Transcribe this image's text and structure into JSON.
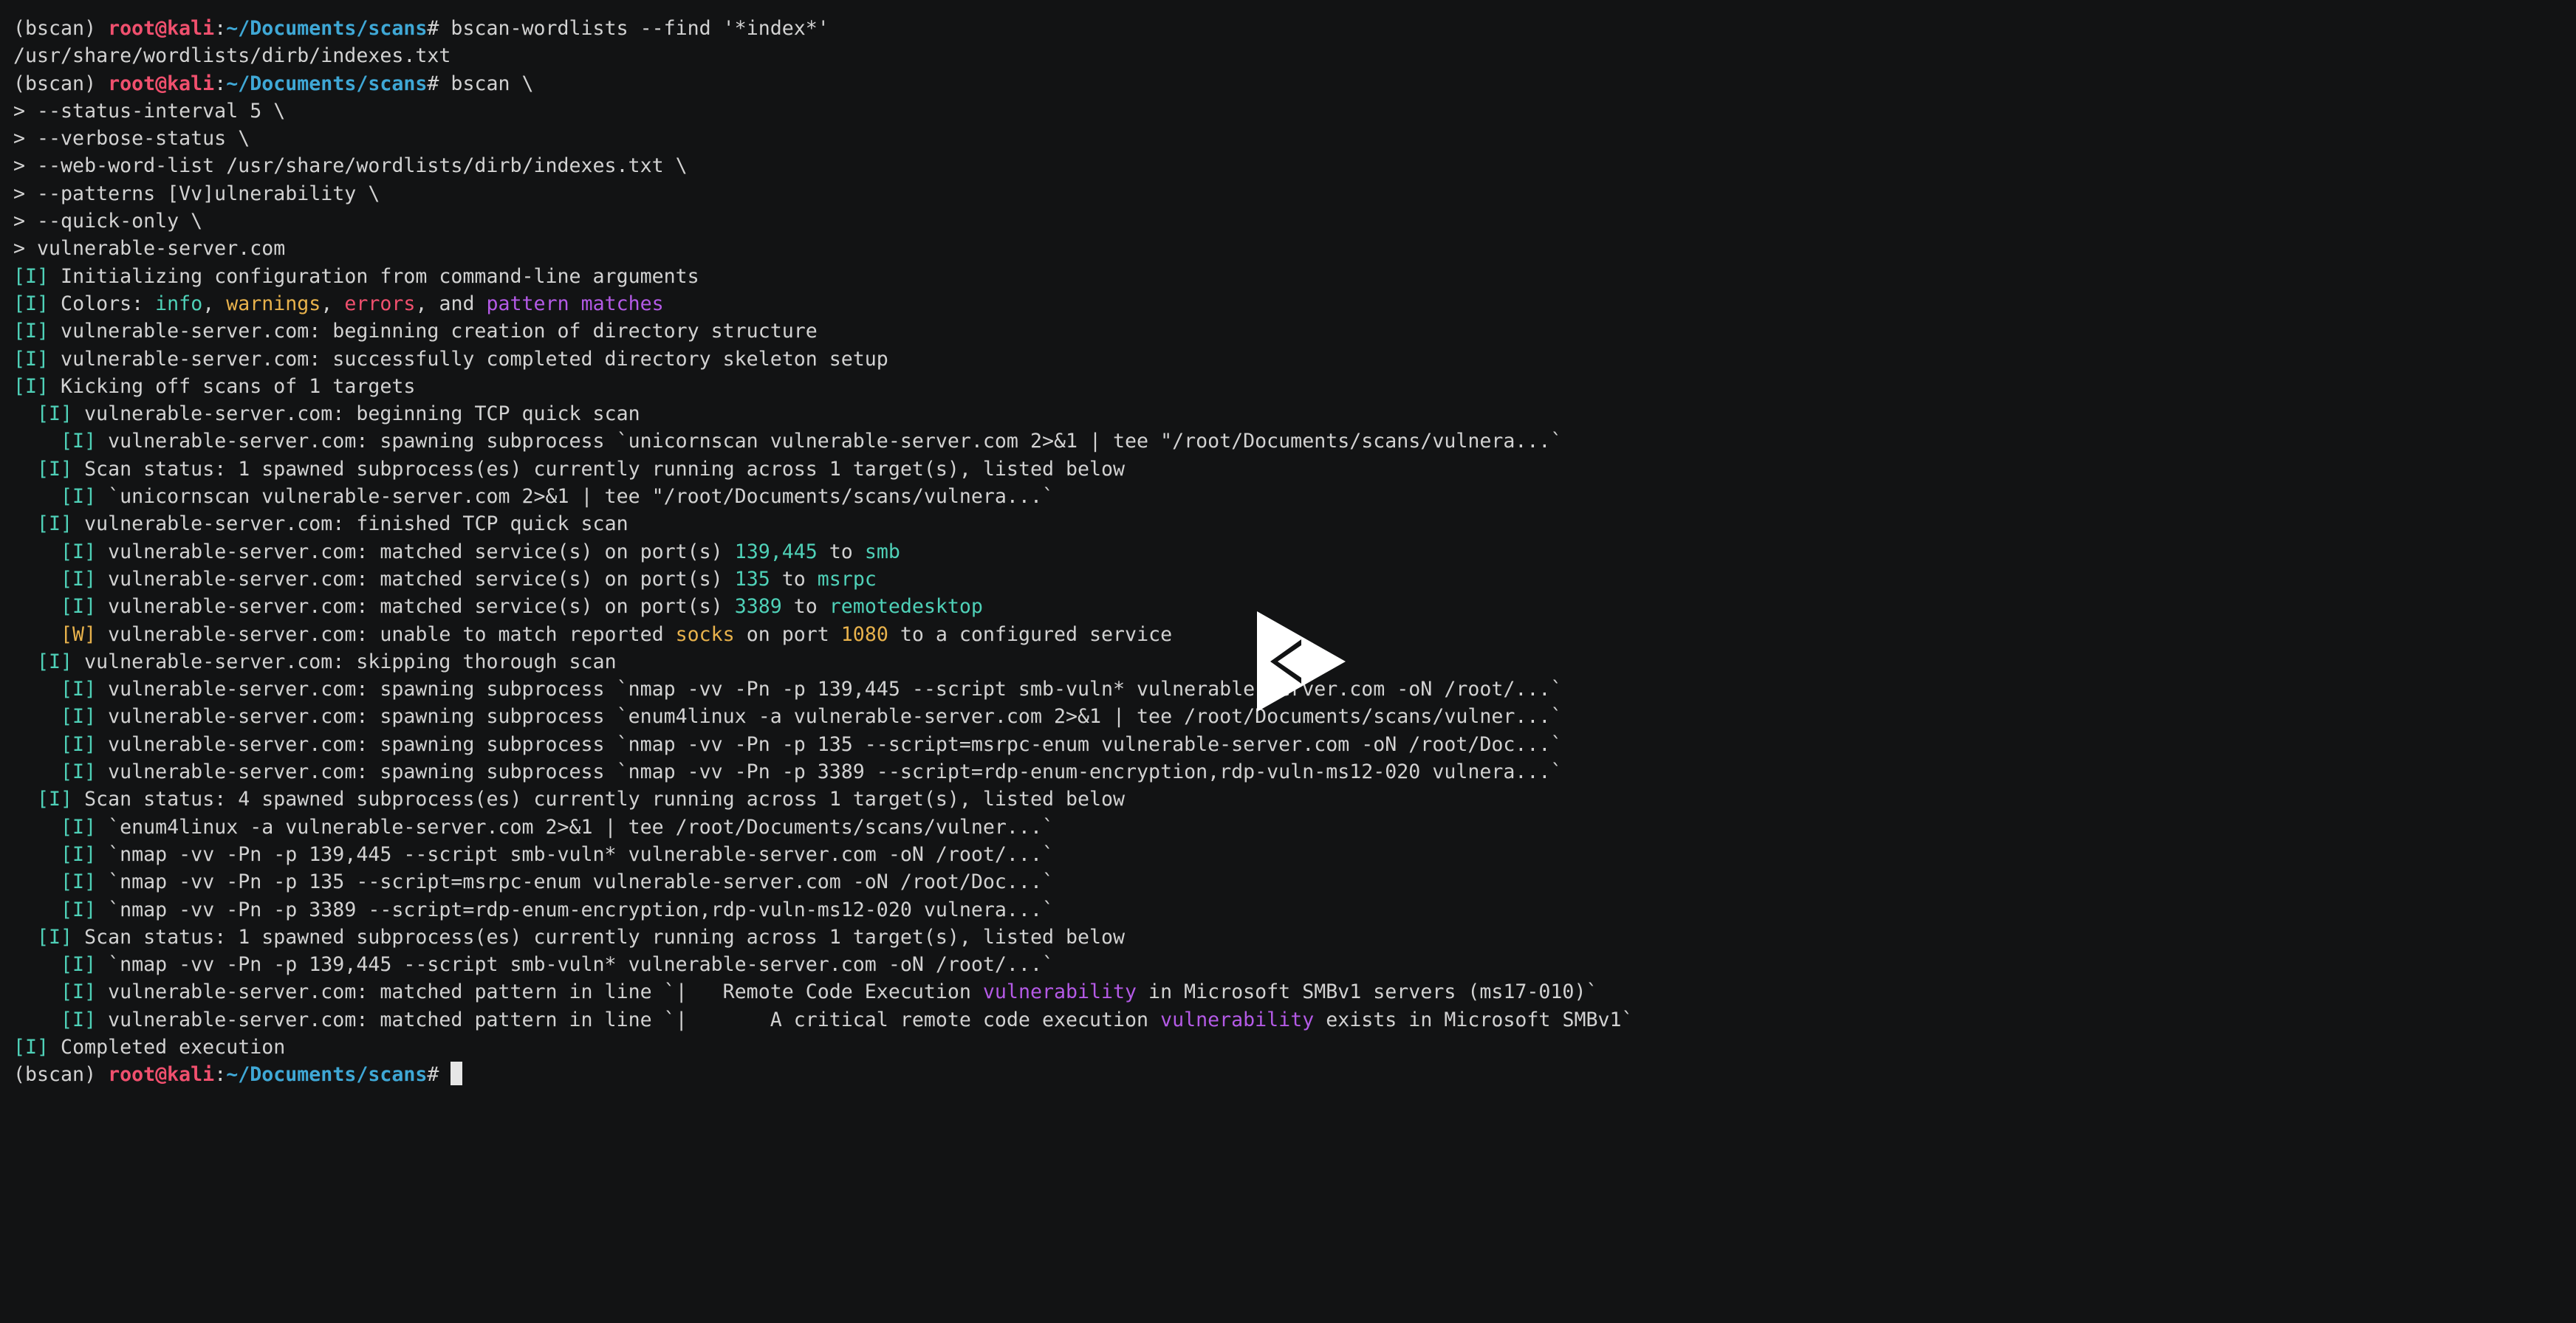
{
  "terminal": {
    "colors": {
      "background": "#121314",
      "text": "#d2d2d2",
      "user": "#f0506e",
      "path": "#3fa8d6",
      "info": "#4fd1b8",
      "warn": "#e8b24c",
      "error": "#f0506e",
      "pattern": "#b45ae6"
    },
    "lines": [
      {
        "kind": "prompt",
        "segments": [
          {
            "t": "(bscan) ",
            "c": "default"
          },
          {
            "t": "root@kali",
            "c": "user"
          },
          {
            "t": ":",
            "c": "default"
          },
          {
            "t": "~/Documents/scans",
            "c": "path"
          },
          {
            "t": "# bscan-wordlists --find '*index*'",
            "c": "default"
          }
        ]
      },
      {
        "kind": "output",
        "segments": [
          {
            "t": "/usr/share/wordlists/dirb/indexes.txt",
            "c": "default"
          }
        ]
      },
      {
        "kind": "prompt",
        "segments": [
          {
            "t": "(bscan) ",
            "c": "default"
          },
          {
            "t": "root@kali",
            "c": "user"
          },
          {
            "t": ":",
            "c": "default"
          },
          {
            "t": "~/Documents/scans",
            "c": "path"
          },
          {
            "t": "# bscan \\",
            "c": "default"
          }
        ]
      },
      {
        "kind": "continuation",
        "segments": [
          {
            "t": "> --status-interval 5 \\",
            "c": "default"
          }
        ]
      },
      {
        "kind": "continuation",
        "segments": [
          {
            "t": "> --verbose-status \\",
            "c": "default"
          }
        ]
      },
      {
        "kind": "continuation",
        "segments": [
          {
            "t": "> --web-word-list /usr/share/wordlists/dirb/indexes.txt \\",
            "c": "default"
          }
        ]
      },
      {
        "kind": "continuation",
        "segments": [
          {
            "t": "> --patterns [Vv]ulnerability \\",
            "c": "default"
          }
        ]
      },
      {
        "kind": "continuation",
        "segments": [
          {
            "t": "> --quick-only \\",
            "c": "default"
          }
        ]
      },
      {
        "kind": "continuation",
        "segments": [
          {
            "t": "> vulnerable-server.com",
            "c": "default"
          }
        ]
      },
      {
        "kind": "log",
        "segments": [
          {
            "t": "[I]",
            "c": "info"
          },
          {
            "t": " Initializing configuration from command-line arguments",
            "c": "default"
          }
        ]
      },
      {
        "kind": "log",
        "segments": [
          {
            "t": "[I]",
            "c": "info"
          },
          {
            "t": " Colors: ",
            "c": "default"
          },
          {
            "t": "info",
            "c": "info"
          },
          {
            "t": ", ",
            "c": "default"
          },
          {
            "t": "warnings",
            "c": "warn"
          },
          {
            "t": ", ",
            "c": "default"
          },
          {
            "t": "errors",
            "c": "err"
          },
          {
            "t": ", and ",
            "c": "default"
          },
          {
            "t": "pattern matches",
            "c": "pattern"
          }
        ]
      },
      {
        "kind": "log",
        "segments": [
          {
            "t": "[I]",
            "c": "info"
          },
          {
            "t": " vulnerable-server.com: beginning creation of directory structure",
            "c": "default"
          }
        ]
      },
      {
        "kind": "log",
        "segments": [
          {
            "t": "[I]",
            "c": "info"
          },
          {
            "t": " vulnerable-server.com: successfully completed directory skeleton setup",
            "c": "default"
          }
        ]
      },
      {
        "kind": "log",
        "segments": [
          {
            "t": "[I]",
            "c": "info"
          },
          {
            "t": " Kicking off scans of 1 targets",
            "c": "default"
          }
        ]
      },
      {
        "kind": "log",
        "segments": [
          {
            "t": "  ",
            "c": "default"
          },
          {
            "t": "[I]",
            "c": "info"
          },
          {
            "t": " vulnerable-server.com: beginning TCP quick scan",
            "c": "default"
          }
        ]
      },
      {
        "kind": "log",
        "segments": [
          {
            "t": "    ",
            "c": "default"
          },
          {
            "t": "[I]",
            "c": "info"
          },
          {
            "t": " vulnerable-server.com: spawning subprocess `unicornscan vulnerable-server.com 2>&1 | tee \"/root/Documents/scans/vulnera...`",
            "c": "default"
          }
        ]
      },
      {
        "kind": "log",
        "segments": [
          {
            "t": "  ",
            "c": "default"
          },
          {
            "t": "[I]",
            "c": "info"
          },
          {
            "t": " Scan status: 1 spawned subprocess(es) currently running across 1 target(s), listed below",
            "c": "default"
          }
        ]
      },
      {
        "kind": "log",
        "segments": [
          {
            "t": "    ",
            "c": "default"
          },
          {
            "t": "[I]",
            "c": "info"
          },
          {
            "t": " `unicornscan vulnerable-server.com 2>&1 | tee \"/root/Documents/scans/vulnera...`",
            "c": "default"
          }
        ]
      },
      {
        "kind": "log",
        "segments": [
          {
            "t": "  ",
            "c": "default"
          },
          {
            "t": "[I]",
            "c": "info"
          },
          {
            "t": " vulnerable-server.com: finished TCP quick scan",
            "c": "default"
          }
        ]
      },
      {
        "kind": "log",
        "segments": [
          {
            "t": "    ",
            "c": "default"
          },
          {
            "t": "[I]",
            "c": "info"
          },
          {
            "t": " vulnerable-server.com: matched service(s) on port(s) ",
            "c": "default"
          },
          {
            "t": "139,445",
            "c": "info"
          },
          {
            "t": " to ",
            "c": "default"
          },
          {
            "t": "smb",
            "c": "info"
          }
        ]
      },
      {
        "kind": "log",
        "segments": [
          {
            "t": "    ",
            "c": "default"
          },
          {
            "t": "[I]",
            "c": "info"
          },
          {
            "t": " vulnerable-server.com: matched service(s) on port(s) ",
            "c": "default"
          },
          {
            "t": "135",
            "c": "info"
          },
          {
            "t": " to ",
            "c": "default"
          },
          {
            "t": "msrpc",
            "c": "info"
          }
        ]
      },
      {
        "kind": "log",
        "segments": [
          {
            "t": "    ",
            "c": "default"
          },
          {
            "t": "[I]",
            "c": "info"
          },
          {
            "t": " vulnerable-server.com: matched service(s) on port(s) ",
            "c": "default"
          },
          {
            "t": "3389",
            "c": "info"
          },
          {
            "t": " to ",
            "c": "default"
          },
          {
            "t": "remotedesktop",
            "c": "info"
          }
        ]
      },
      {
        "kind": "log",
        "segments": [
          {
            "t": "    ",
            "c": "default"
          },
          {
            "t": "[W]",
            "c": "warn"
          },
          {
            "t": " vulnerable-server.com: unable to match reported ",
            "c": "default"
          },
          {
            "t": "socks",
            "c": "warn"
          },
          {
            "t": " on port ",
            "c": "default"
          },
          {
            "t": "1080",
            "c": "warn"
          },
          {
            "t": " to a configured service",
            "c": "default"
          }
        ]
      },
      {
        "kind": "log",
        "segments": [
          {
            "t": "  ",
            "c": "default"
          },
          {
            "t": "[I]",
            "c": "info"
          },
          {
            "t": " vulnerable-server.com: skipping thorough scan",
            "c": "default"
          }
        ]
      },
      {
        "kind": "log",
        "segments": [
          {
            "t": "    ",
            "c": "default"
          },
          {
            "t": "[I]",
            "c": "info"
          },
          {
            "t": " vulnerable-server.com: spawning subprocess `nmap -vv -Pn -p 139,445 --script smb-vuln* vulnerable-server.com -oN /root/...`",
            "c": "default"
          }
        ]
      },
      {
        "kind": "log",
        "segments": [
          {
            "t": "    ",
            "c": "default"
          },
          {
            "t": "[I]",
            "c": "info"
          },
          {
            "t": " vulnerable-server.com: spawning subprocess `enum4linux -a vulnerable-server.com 2>&1 | tee /root/Documents/scans/vulner...`",
            "c": "default"
          }
        ]
      },
      {
        "kind": "log",
        "segments": [
          {
            "t": "    ",
            "c": "default"
          },
          {
            "t": "[I]",
            "c": "info"
          },
          {
            "t": " vulnerable-server.com: spawning subprocess `nmap -vv -Pn -p 135 --script=msrpc-enum vulnerable-server.com -oN /root/Doc...`",
            "c": "default"
          }
        ]
      },
      {
        "kind": "log",
        "segments": [
          {
            "t": "    ",
            "c": "default"
          },
          {
            "t": "[I]",
            "c": "info"
          },
          {
            "t": " vulnerable-server.com: spawning subprocess `nmap -vv -Pn -p 3389 --script=rdp-enum-encryption,rdp-vuln-ms12-020 vulnera...`",
            "c": "default"
          }
        ]
      },
      {
        "kind": "log",
        "segments": [
          {
            "t": "  ",
            "c": "default"
          },
          {
            "t": "[I]",
            "c": "info"
          },
          {
            "t": " Scan status: 4 spawned subprocess(es) currently running across 1 target(s), listed below",
            "c": "default"
          }
        ]
      },
      {
        "kind": "log",
        "segments": [
          {
            "t": "    ",
            "c": "default"
          },
          {
            "t": "[I]",
            "c": "info"
          },
          {
            "t": " `enum4linux -a vulnerable-server.com 2>&1 | tee /root/Documents/scans/vulner...`",
            "c": "default"
          }
        ]
      },
      {
        "kind": "log",
        "segments": [
          {
            "t": "    ",
            "c": "default"
          },
          {
            "t": "[I]",
            "c": "info"
          },
          {
            "t": " `nmap -vv -Pn -p 139,445 --script smb-vuln* vulnerable-server.com -oN /root/...`",
            "c": "default"
          }
        ]
      },
      {
        "kind": "log",
        "segments": [
          {
            "t": "    ",
            "c": "default"
          },
          {
            "t": "[I]",
            "c": "info"
          },
          {
            "t": " `nmap -vv -Pn -p 135 --script=msrpc-enum vulnerable-server.com -oN /root/Doc...`",
            "c": "default"
          }
        ]
      },
      {
        "kind": "log",
        "segments": [
          {
            "t": "    ",
            "c": "default"
          },
          {
            "t": "[I]",
            "c": "info"
          },
          {
            "t": " `nmap -vv -Pn -p 3389 --script=rdp-enum-encryption,rdp-vuln-ms12-020 vulnera...`",
            "c": "default"
          }
        ]
      },
      {
        "kind": "log",
        "segments": [
          {
            "t": "  ",
            "c": "default"
          },
          {
            "t": "[I]",
            "c": "info"
          },
          {
            "t": " Scan status: 1 spawned subprocess(es) currently running across 1 target(s), listed below",
            "c": "default"
          }
        ]
      },
      {
        "kind": "log",
        "segments": [
          {
            "t": "    ",
            "c": "default"
          },
          {
            "t": "[I]",
            "c": "info"
          },
          {
            "t": " `nmap -vv -Pn -p 139,445 --script smb-vuln* vulnerable-server.com -oN /root/...`",
            "c": "default"
          }
        ]
      },
      {
        "kind": "log",
        "segments": [
          {
            "t": "    ",
            "c": "default"
          },
          {
            "t": "[I]",
            "c": "info"
          },
          {
            "t": " vulnerable-server.com: matched pattern in line `|   Remote Code Execution ",
            "c": "default"
          },
          {
            "t": "vulnerability",
            "c": "pattern"
          },
          {
            "t": " in Microsoft SMBv1 servers (ms17-010)`",
            "c": "default"
          }
        ]
      },
      {
        "kind": "log",
        "segments": [
          {
            "t": "    ",
            "c": "default"
          },
          {
            "t": "[I]",
            "c": "info"
          },
          {
            "t": " vulnerable-server.com: matched pattern in line `|       A critical remote code execution ",
            "c": "default"
          },
          {
            "t": "vulnerability",
            "c": "pattern"
          },
          {
            "t": " exists in Microsoft SMBv1`",
            "c": "default"
          }
        ]
      },
      {
        "kind": "log",
        "segments": [
          {
            "t": "[I]",
            "c": "info"
          },
          {
            "t": " Completed execution",
            "c": "default"
          }
        ]
      },
      {
        "kind": "prompt",
        "cursor": true,
        "segments": [
          {
            "t": "(bscan) ",
            "c": "default"
          },
          {
            "t": "root@kali",
            "c": "user"
          },
          {
            "t": ":",
            "c": "default"
          },
          {
            "t": "~/Documents/scans",
            "c": "path"
          },
          {
            "t": "# ",
            "c": "default"
          }
        ]
      }
    ]
  },
  "overlay": {
    "icon": "play-logo-icon"
  }
}
